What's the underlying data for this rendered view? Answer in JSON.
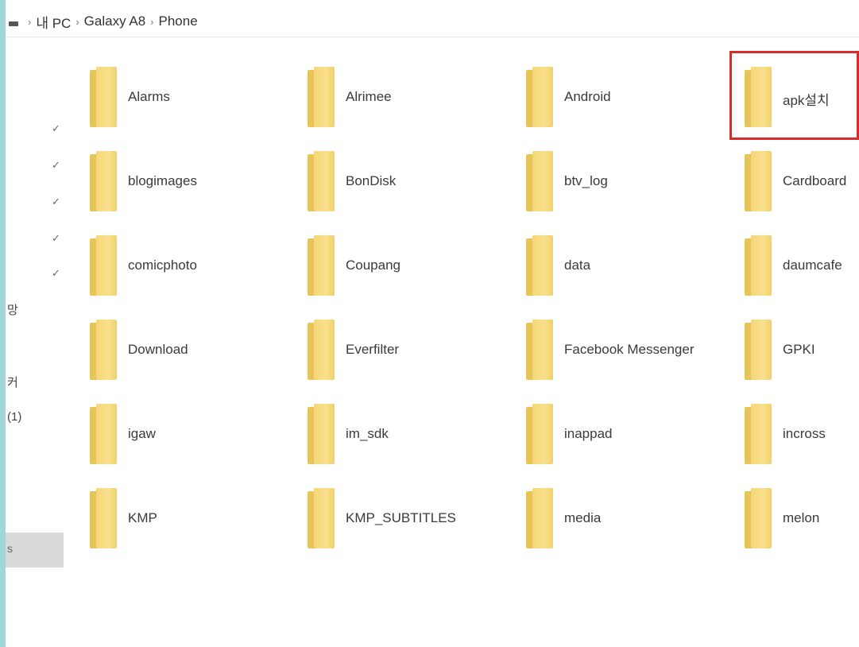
{
  "breadcrumb": {
    "items": [
      "내 PC",
      "Galaxy A8",
      "Phone"
    ]
  },
  "nav": {
    "partial_labels": [
      "망",
      "커",
      "(1)",
      "s"
    ]
  },
  "folders": [
    {
      "name": "Alarms"
    },
    {
      "name": "Alrimee"
    },
    {
      "name": "Android"
    },
    {
      "name": "apk설치"
    },
    {
      "name": "blogimages"
    },
    {
      "name": "BonDisk"
    },
    {
      "name": "btv_log"
    },
    {
      "name": "Cardboard"
    },
    {
      "name": "comicphoto"
    },
    {
      "name": "Coupang"
    },
    {
      "name": "data"
    },
    {
      "name": "daumcafe"
    },
    {
      "name": "Download"
    },
    {
      "name": "Everfilter"
    },
    {
      "name": "Facebook Messenger"
    },
    {
      "name": "GPKI"
    },
    {
      "name": "igaw"
    },
    {
      "name": "im_sdk"
    },
    {
      "name": "inappad"
    },
    {
      "name": "incross"
    },
    {
      "name": "KMP"
    },
    {
      "name": "KMP_SUBTITLES"
    },
    {
      "name": "media"
    },
    {
      "name": "melon"
    }
  ],
  "highlighted_folder": "apk설치",
  "colors": {
    "highlight": "#d92b2b",
    "folder": "#f6d776",
    "frame": "#9ed8d6"
  }
}
